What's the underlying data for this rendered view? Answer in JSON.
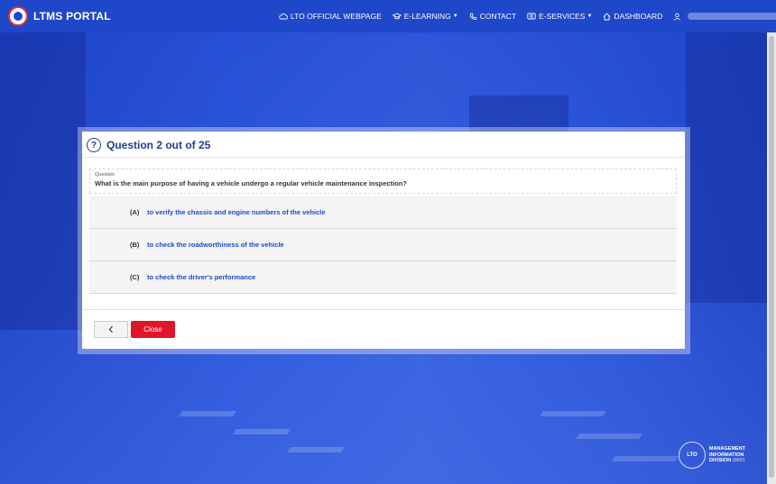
{
  "header": {
    "brand": "LTMS PORTAL",
    "nav": [
      {
        "label": "LTO OFFICIAL WEBPAGE",
        "icon": "cloud-icon",
        "dropdown": false
      },
      {
        "label": "E-LEARNING",
        "icon": "graduation-cap-icon",
        "dropdown": true
      },
      {
        "label": "CONTACT",
        "icon": "phone-icon",
        "dropdown": false
      },
      {
        "label": "E-SERVICES",
        "icon": "services-icon",
        "dropdown": true
      },
      {
        "label": "DASHBOARD",
        "icon": "home-icon",
        "dropdown": false
      }
    ],
    "user_icon": "user-icon"
  },
  "modal": {
    "title": "Question 2 out of 25",
    "question_label": "Question",
    "question_text": "What is the main purpose of having a vehicle undergo a regular vehicle maintenance inspection?",
    "choices": [
      {
        "letter": "(A)",
        "text": "to verify the chassis and engine numbers of the vehicle"
      },
      {
        "letter": "(B)",
        "text": "to check the roadworthiness of the vehicle"
      },
      {
        "letter": "(C)",
        "text": "to check the driver's performance"
      }
    ],
    "prev_icon": "chevron-left-icon",
    "close_label": "Close"
  },
  "footer_logo": {
    "badge": "LTO",
    "line1": "MANAGEMENT",
    "line2": "INFORMATION",
    "line3": "DIVISION",
    "abbr": "(MID)"
  },
  "colors": {
    "header_bg": "#1f47c9",
    "title": "#1f3e8c",
    "choice_text": "#1f47c9",
    "close_button": "#e0152a"
  }
}
